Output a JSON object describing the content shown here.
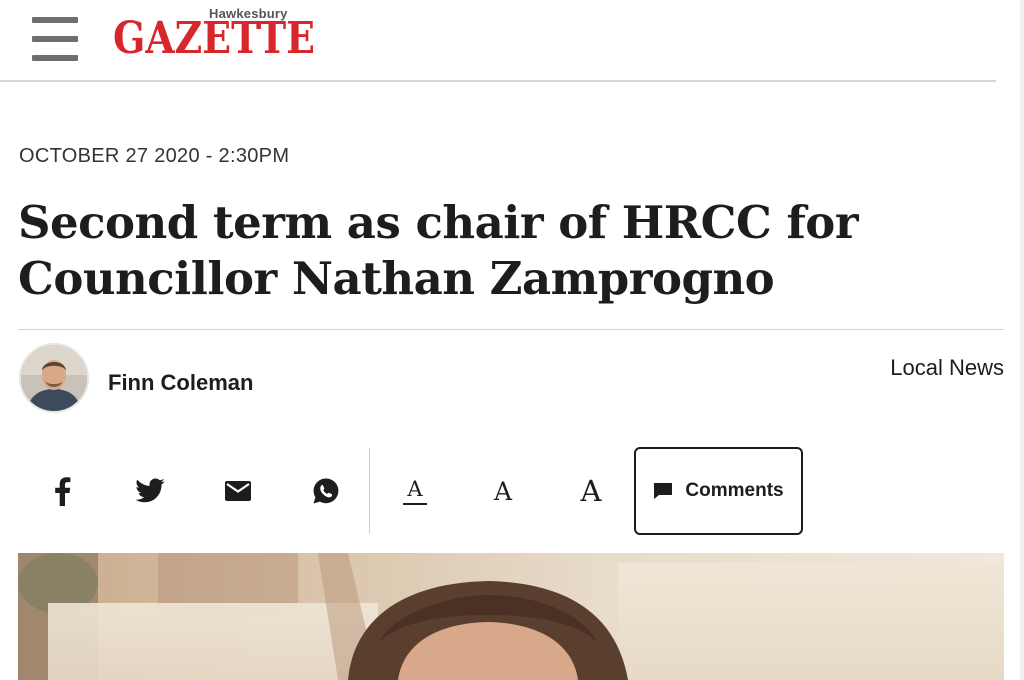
{
  "header": {
    "logo_small": "Hawkesbury",
    "logo_main": "GAZETTE",
    "brand_color": "#d8262d",
    "menu_icon": "hamburger-menu-icon"
  },
  "article": {
    "dateline": "OCTOBER 27 2020 - 2:30PM",
    "headline_line1": "Second term as chair of HRCC for",
    "headline_line2": "Councillor Nathan Zamprogno",
    "author": "Finn Coleman",
    "section": "Local News"
  },
  "toolbar": {
    "share_icons": [
      "facebook-icon",
      "twitter-icon",
      "email-icon",
      "whatsapp-icon"
    ],
    "font_size_options": [
      "A",
      "A",
      "A"
    ],
    "comments_label": "Comments",
    "comments_icon": "comment-bubble-icon"
  },
  "hero_image": {
    "description_icon": "article-photo"
  }
}
